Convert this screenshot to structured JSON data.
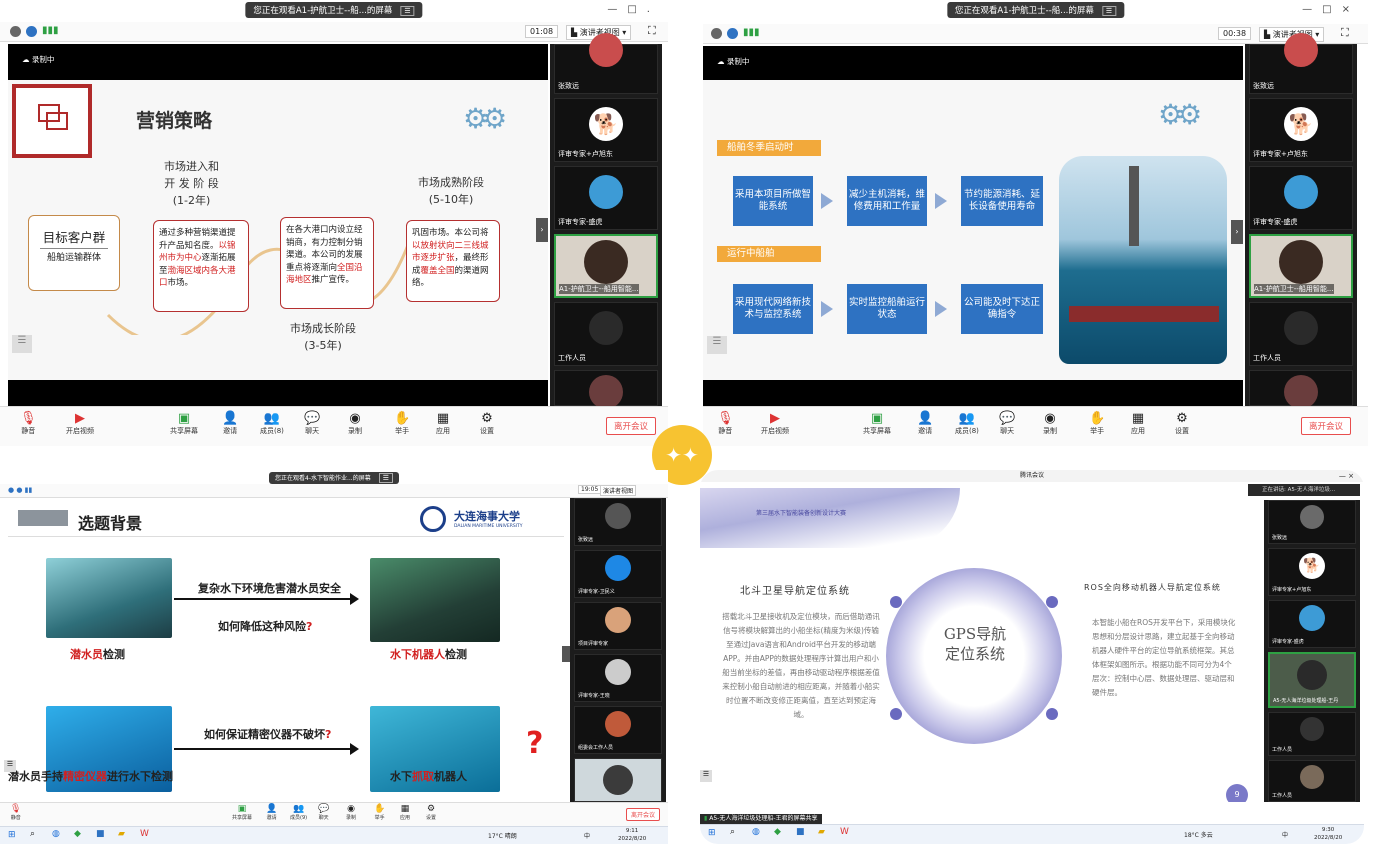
{
  "q1": {
    "share_banner": "您正在观看A1-护航卫士--船...的屏幕",
    "timer": "01:08",
    "view_label": "演讲者视图",
    "recording": "录制中",
    "slide": {
      "title": "营销策略",
      "target_title": "目标客户群",
      "target_sub": "船舶运输群体",
      "stage1_title": "市场进入和\n开 发 阶 段\n(1-2年)",
      "stage1_pre": "通过多种营销渠道提升产品知名度。",
      "stage1_hl": "以锦州市为中心",
      "stage1_mid": "逐渐拓展至",
      "stage1_hl2": "渤海区域",
      "stage1_hl3": "内各大港口",
      "stage1_post": "市场。",
      "stage2_pre": "在各大港口内设立经销商，有力控制分销渠道。本公司的发展重点将逐渐向",
      "stage2_hl": "全国沿海地区",
      "stage2_post": "推广宣传。",
      "stage2_title": "市场成长阶段\n(3-5年)",
      "stage3_title": "市场成熟阶段\n(5-10年)",
      "stage3_pre": "巩固市场。本公司将",
      "stage3_hl": "以放射状向二三线城市逐步扩张",
      "stage3_mid": "，最终形成",
      "stage3_hl2": "覆盖全国",
      "stage3_post": "的渠道网络。"
    },
    "participants": [
      "张致远",
      "评审专家+卢旭东",
      "评审专家-盛虎",
      "A1-护航卫士--船用智能...",
      "工作人员"
    ],
    "toolbar": [
      "静音",
      "开启视频",
      "共享屏幕",
      "邀请",
      "成员(8)",
      "聊天",
      "录制",
      "举手",
      "应用",
      "设置"
    ],
    "leave": "离开会议"
  },
  "q2": {
    "share_banner": "您正在观看A1-护航卫士--船...的屏幕",
    "timer": "00:38",
    "view_label": "演讲者视图",
    "recording": "录制中",
    "slide": {
      "section1": "船舶冬季启动时",
      "row1": [
        "采用本项目所做智能系统",
        "减少主机消耗，维修费用和工作量",
        "节约能源消耗、延长设备使用寿命"
      ],
      "section2": "运行中船舶",
      "row2": [
        "采用现代网络新技术与监控系统",
        "实时监控船舶运行状态",
        "公司能及时下达正确指令"
      ]
    },
    "participants": [
      "张致远",
      "评审专家+卢旭东",
      "评审专家-盛虎",
      "A1-护航卫士--船用智能...",
      "工作人员"
    ],
    "toolbar": [
      "静音",
      "开启视频",
      "共享屏幕",
      "邀请",
      "成员(8)",
      "聊天",
      "录制",
      "举手",
      "应用",
      "设置"
    ],
    "leave": "离开会议"
  },
  "q3": {
    "share_banner": "您正在观看4-水下智能作业...的屏幕",
    "timer": "19:05",
    "view_label": "演讲者视图",
    "slide": {
      "title": "选题背景",
      "university": "大连海事大学",
      "university_en": "DALIAN MARITIME UNIVERSITY",
      "line1": "复杂水下环境危害潜水员安全",
      "line2": "如何降低这种风险",
      "line3": "如何保证精密仪器不破坏",
      "cap1_hl": "潜水员",
      "cap1": "检测",
      "cap2_hl": "水下机器人",
      "cap2": "检测",
      "cap3_pre": "潜水员手持",
      "cap3_hl": "精密仪器",
      "cap3_post": "进行水下检测",
      "cap4_pre": "水下",
      "cap4_hl": "抓取",
      "cap4_post": "机器人",
      "qmark": "?"
    },
    "participants": [
      "张致远",
      "评审专家-卫民义",
      "项目评审专家",
      "评审专家-王晓",
      "组委会工作人员",
      ""
    ],
    "toolbar": [
      "静音",
      "共享屏幕",
      "邀请",
      "成员(9)",
      "聊天",
      "录制",
      "举手",
      "应用",
      "设置"
    ],
    "leave": "离开会议",
    "taskbar": {
      "weather": "17°C 晴朗",
      "time": "9:11",
      "date": "2022/8/20",
      "lang": "中"
    }
  },
  "q4": {
    "window_title": "腾讯会议",
    "slide": {
      "header": "第三届水下智能装备创新设计大赛",
      "left_title": "北斗卫星导航定位系统",
      "left_body": "搭载北斗卫星接收机及定位模块，而后借助通讯信号将模块解算出的小船坐标(精度为米级)传输至通过Java语言和Android平台开发的移动端APP。并由APP的数据处理程序计算出用户和小船当前坐标的差值，再由移动驱动程序根据差值来控制小船自动前进的相应距离，并随着小船实时位置不断改变修正距离值，直至达到预定海域。",
      "center": "GPS导航\n定位系统",
      "right_title": "ROS全向移动机器人导航定位系统",
      "right_body": "本智能小船在ROS开发平台下，采用模块化思想和分层设计思路，建立起基于全向移动机器人硬件平台的定位导航系统框架。其总体框架如图所示。根据功能不同可分为4个层次：控制中心层、数据处理层、驱动层和硬件层。",
      "page": "9"
    },
    "speaker_label": "正在讲话: A5-无人海洋垃圾...",
    "participants": [
      "张致远",
      "评审专家+卢旭东",
      "评审专家-盛虎",
      "A5-无人海洋垃圾处理船-王丹",
      "工作人员",
      "工作人员"
    ],
    "bottom_label": "A5-无人海洋垃圾处理船-王君的屏幕共享",
    "taskbar": {
      "weather": "18°C 多云",
      "time": "9:30",
      "date": "2022/8/20",
      "lang": "中"
    }
  },
  "colors": {
    "accent_red": "#b53030",
    "zoom_blue": "#2e72c2",
    "badge": "#f7c331"
  }
}
